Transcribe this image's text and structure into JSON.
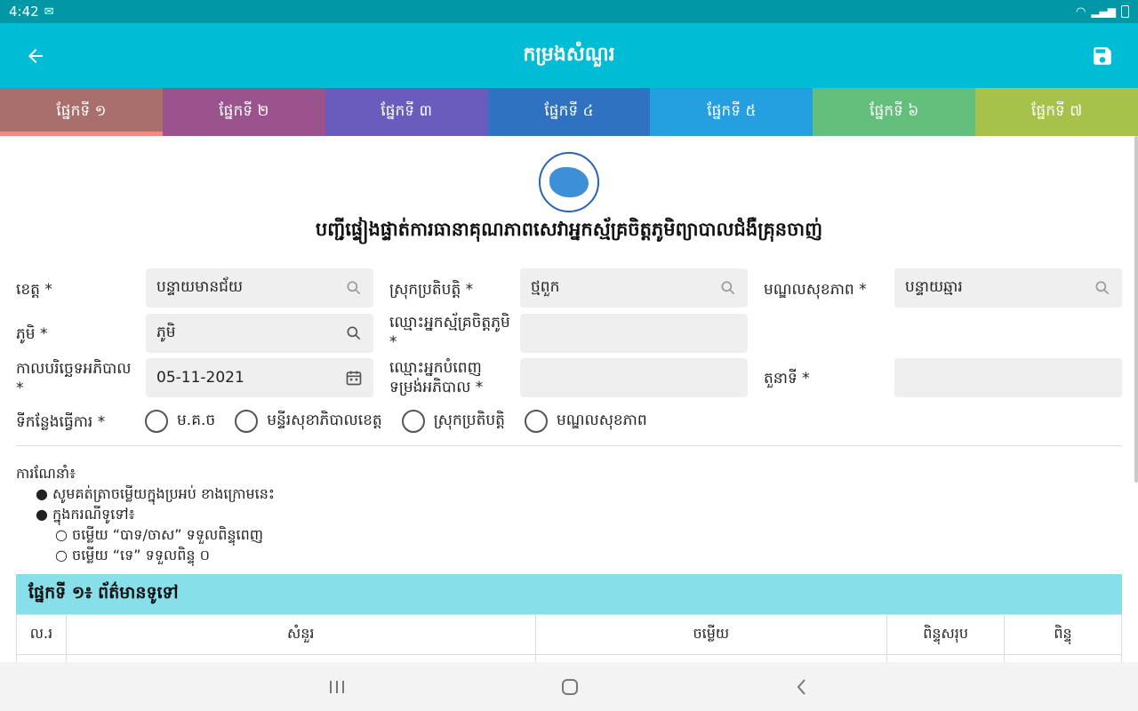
{
  "status": {
    "time": "4:42",
    "mail_icon": "gmail-icon"
  },
  "appbar": {
    "title": "កម្រងសំណួរ",
    "back_icon": "arrow-left-icon",
    "save_icon": "save-icon"
  },
  "tabs": [
    {
      "label": "ផ្នែកទី ១",
      "color": "#a86f6c"
    },
    {
      "label": "ផ្នែកទី ២",
      "color": "#9b538e"
    },
    {
      "label": "ផ្នែកទី ៣",
      "color": "#6a5cbc"
    },
    {
      "label": "ផ្នែកទី ៤",
      "color": "#2f72c1"
    },
    {
      "label": "ផ្នែកទី ៥",
      "color": "#24a0e0"
    },
    {
      "label": "ផ្នែកទី ៦",
      "color": "#63c07c"
    },
    {
      "label": "ផ្នែកទី ៧",
      "color": "#a6c24a"
    }
  ],
  "form": {
    "heading": "បញ្ជីផ្ទៀងផ្ទាត់ការធានាគុណភាពសេវាអ្នកស្ម័គ្រចិត្តភូមិព្យាបាលជំងឺគ្រុនចាញ់",
    "province_label": "ខេត្ត *",
    "province_value": "បន្ទាយមានជ័យ",
    "od_label": "ស្រុកប្រតិបត្តិ *",
    "od_value": "ថ្មពួក",
    "hc_label": "មណ្ឌលសុខភាព *",
    "hc_value": "បន្ទាយឆ្មារ",
    "village_label": "ភូមិ *",
    "village_value": "ភូមិ",
    "vmw_label": "ឈ្មោះអ្នកស្ម័គ្រចិត្តភូមិ *",
    "vmw_value": "",
    "date_label": "កាលបរិច្ឆេទអភិបាល *",
    "date_value": "05-11-2021",
    "supervisor_label": "ឈ្មោះអ្នកបំពេញទម្រង់អភិបាល *",
    "supervisor_value": "",
    "role_label": "តួនាទី *",
    "role_value": "",
    "workplace_label": "ទីកន្លែងធ្វើការ *",
    "workplace_options": [
      "ម.គ.ច",
      "មន្ទីរសុខាភិបាលខេត្ត",
      "ស្រុកប្រតិបត្តិ",
      "មណ្ឌលសុខភាព"
    ]
  },
  "guidance": {
    "title": "ការណែនាំ៖",
    "bullet1": "● សូមគត់ត្រាចម្លើយក្នុងប្រអប់ ខាងក្រោមនេះ",
    "bullet2": "● ក្នុងករណីទូទៅ៖",
    "sub1": "○ ចម្លើយ “បាទ/ចាស” ទទួលពិន្ទុពេញ",
    "sub2": "○ ចម្លើយ “ទេ” ទទួលពិន្ទុ ០"
  },
  "section": {
    "title": "ផ្នែកទី ១៖ ព័ត៌មានទូទៅ",
    "columns": [
      "ល.រ",
      "សំនួរ",
      "ចម្លើយ",
      "ពិន្ទុសរុប",
      "ពិន្ទុ"
    ]
  },
  "icons": {
    "search": "search-icon",
    "calendar": "calendar-icon"
  }
}
